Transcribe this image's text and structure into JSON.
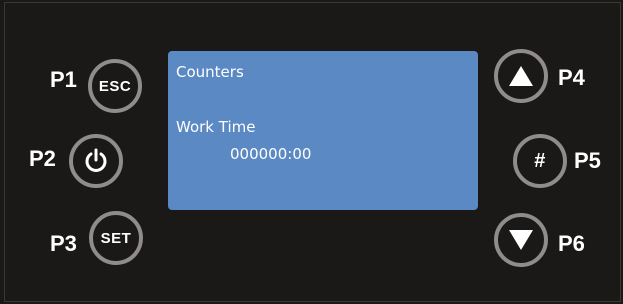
{
  "buttons": {
    "p1": {
      "label": "P1",
      "text": "ESC"
    },
    "p2": {
      "label": "P2",
      "icon": "power-icon"
    },
    "p3": {
      "label": "P3",
      "text": "SET"
    },
    "p4": {
      "label": "P4",
      "icon": "triangle-up-icon"
    },
    "p5": {
      "label": "P5",
      "text": "#"
    },
    "p6": {
      "label": "P6",
      "icon": "triangle-down-icon"
    }
  },
  "display": {
    "title": "Counters",
    "item_label": "Work Time",
    "item_value": "000000:00",
    "background_color": "#5b89c3"
  }
}
